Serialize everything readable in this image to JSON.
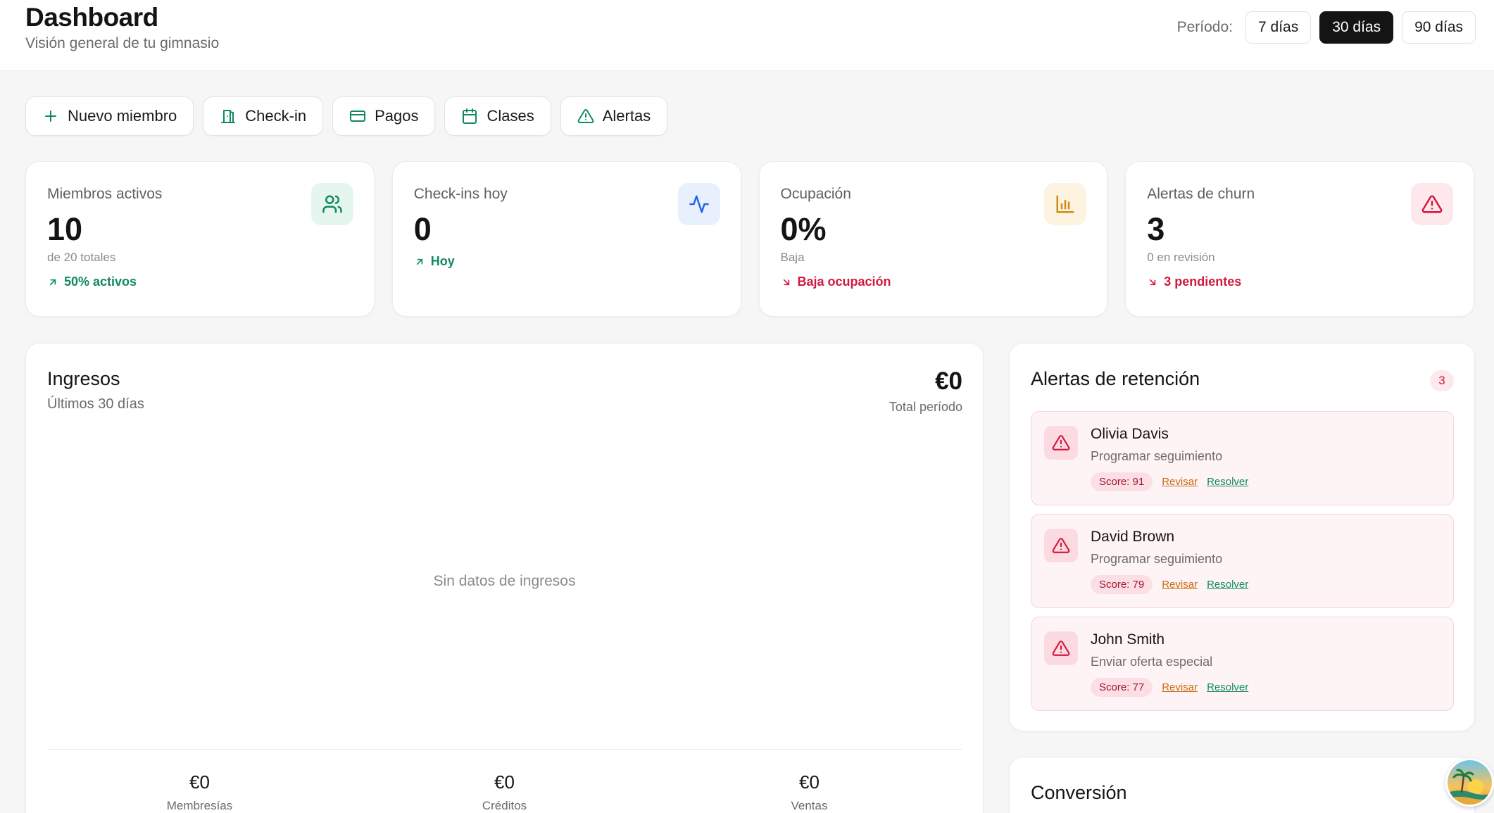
{
  "header": {
    "title": "Dashboard",
    "subtitle": "Visión general de tu gimnasio",
    "period_label": "Período:",
    "periods": [
      "7 días",
      "30 días",
      "90 días"
    ],
    "active_period": "30 días"
  },
  "actions": [
    {
      "label": "Nuevo miembro",
      "icon": "plus-icon"
    },
    {
      "label": "Check-in",
      "icon": "door-icon"
    },
    {
      "label": "Pagos",
      "icon": "credit-card-icon"
    },
    {
      "label": "Clases",
      "icon": "calendar-icon"
    },
    {
      "label": "Alertas",
      "icon": "warning-triangle-icon"
    }
  ],
  "stats": [
    {
      "title": "Miembros activos",
      "value": "10",
      "sub": "de 20 totales",
      "trend": "50% activos",
      "trend_dir": "up",
      "icon": "users-icon",
      "icon_color": "#0f8a5f",
      "icon_bg": "#e5f6ef"
    },
    {
      "title": "Check-ins hoy",
      "value": "0",
      "sub": "",
      "trend": "Hoy",
      "trend_dir": "up",
      "icon": "activity-icon",
      "icon_color": "#2563eb",
      "icon_bg": "#e8f0fe"
    },
    {
      "title": "Ocupación",
      "value": "0%",
      "sub": "Baja",
      "trend": "Baja ocupación",
      "trend_dir": "down",
      "icon": "bar-chart-icon",
      "icon_color": "#d48a12",
      "icon_bg": "#fdf3e1"
    },
    {
      "title": "Alertas de churn",
      "value": "3",
      "sub": "0 en revisión",
      "trend": "3 pendientes",
      "trend_dir": "down",
      "icon": "warning-triangle-icon",
      "icon_color": "#d1193f",
      "icon_bg": "#fde8ec"
    }
  ],
  "revenue": {
    "title": "Ingresos",
    "subtitle": "Últimos 30 días",
    "total": "€0",
    "total_label": "Total período",
    "empty_text": "Sin datos de ingresos",
    "breakdown": [
      {
        "value": "€0",
        "label": "Membresías"
      },
      {
        "value": "€0",
        "label": "Créditos"
      },
      {
        "value": "€0",
        "label": "Ventas"
      }
    ]
  },
  "retention": {
    "title": "Alertas de retención",
    "count": "3",
    "items": [
      {
        "name": "Olivia Davis",
        "action": "Programar seguimiento",
        "score": "Score: 91",
        "review": "Revisar",
        "resolve": "Resolver"
      },
      {
        "name": "David Brown",
        "action": "Programar seguimiento",
        "score": "Score: 79",
        "review": "Revisar",
        "resolve": "Resolver"
      },
      {
        "name": "John Smith",
        "action": "Enviar oferta especial",
        "score": "Score: 77",
        "review": "Revisar",
        "resolve": "Resolver"
      }
    ]
  },
  "conversion": {
    "title": "Conversión"
  },
  "colors": {
    "accent": "#141414",
    "success": "#0f8a5f",
    "danger": "#d1193f",
    "warning": "#c76a0f"
  }
}
